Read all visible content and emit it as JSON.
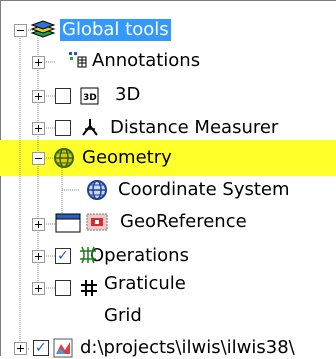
{
  "tree": {
    "root": {
      "label": "Global tools",
      "expanded": true,
      "selected": true
    },
    "items": [
      {
        "label": "Annotations",
        "expander": "plus"
      },
      {
        "label": "3D",
        "expander": "plus",
        "checked": false
      },
      {
        "label": "Distance Measurer",
        "expander": "plus",
        "checked": false
      },
      {
        "label": "Geometry",
        "expander": "minus",
        "highlighted": true,
        "children": [
          {
            "label": "Coordinate System"
          },
          {
            "label": "GeoReference"
          }
        ]
      },
      {
        "label": "Operations",
        "expander": "plus"
      },
      {
        "label": "Graticule",
        "expander": "plus",
        "checked": true
      },
      {
        "label": "Grid",
        "expander": "plus",
        "checked": false
      }
    ],
    "bottom_item": {
      "label": "d:\\projects\\ilwis\\ilwis38\\",
      "expander": "plus",
      "checked": true
    }
  },
  "colors": {
    "highlight": "#ffff2a",
    "selection": "#3399ff",
    "checkmark": "#1c5fd6"
  }
}
